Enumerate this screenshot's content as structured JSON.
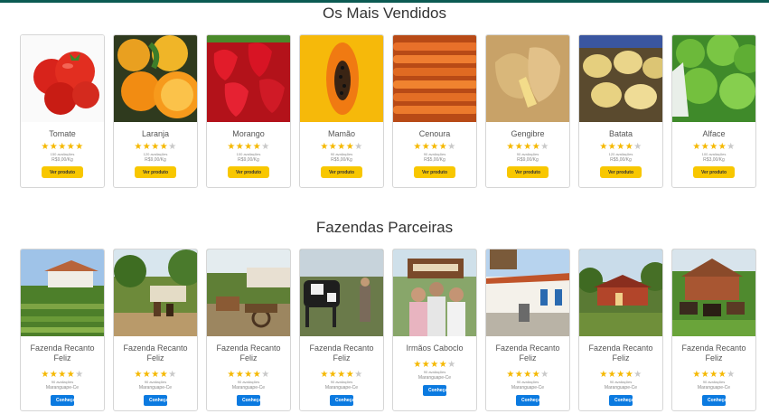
{
  "page": {
    "top_title": "Os Mais Vendidos",
    "farms_title": "Fazendas Parceiras"
  },
  "products": [
    {
      "name": "Tomate",
      "stars": 5,
      "reviews": "150 avaliações",
      "price": "R$9,00/Kg",
      "button": "Ver produto",
      "image": "tomato"
    },
    {
      "name": "Laranja",
      "stars": 4,
      "reviews": "120 avaliações",
      "price": "R$9,00/Kg",
      "button": "Ver produto",
      "image": "orange"
    },
    {
      "name": "Morango",
      "stars": 4,
      "reviews": "100 avaliações",
      "price": "R$9,00/Kg",
      "button": "Ver produto",
      "image": "strawberry"
    },
    {
      "name": "Mamão",
      "stars": 4,
      "reviews": "90 avaliações",
      "price": "R$5,00/Kg",
      "button": "Ver produto",
      "image": "papaya"
    },
    {
      "name": "Cenoura",
      "stars": 4,
      "reviews": "90 avaliações",
      "price": "R$5,00/Kg",
      "button": "Ver produto",
      "image": "carrot"
    },
    {
      "name": "Gengibre",
      "stars": 4,
      "reviews": "90 avaliações",
      "price": "R$9,00/Kg",
      "button": "Ver produto",
      "image": "ginger"
    },
    {
      "name": "Batata",
      "stars": 4,
      "reviews": "120 avaliações",
      "price": "R$5,00/Kg",
      "button": "Ver produto",
      "image": "potato"
    },
    {
      "name": "Alface",
      "stars": 4,
      "reviews": "100 avaliações",
      "price": "R$3,00/Kg",
      "button": "Ver produto",
      "image": "lettuce"
    }
  ],
  "farms": [
    {
      "name": "Fazenda Recanto Feliz",
      "stars": 4,
      "reviews": "90 avaliações",
      "location": "Maranguape-Ce",
      "button": "Conheça",
      "image": "farm-garden"
    },
    {
      "name": "Fazenda Recanto Feliz",
      "stars": 4,
      "reviews": "90 avaliações",
      "location": "Maranguape-Ce",
      "button": "Conheça",
      "image": "farm-horses"
    },
    {
      "name": "Fazenda Recanto Feliz",
      "stars": 4,
      "reviews": "90 avaliações",
      "location": "Maranguape-Ce",
      "button": "Conheça",
      "image": "farm-cart"
    },
    {
      "name": "Fazenda Recanto Feliz",
      "stars": 4,
      "reviews": "90 avaliações",
      "location": "Maranguape-Ce",
      "button": "Conheça",
      "image": "farm-cows"
    },
    {
      "name": "Irmãos Caboclo",
      "stars": 4,
      "reviews": "90 avaliações",
      "location": "Maranguape-Ce",
      "button": "Conheça",
      "image": "farm-people"
    },
    {
      "name": "Fazenda Recanto Feliz",
      "stars": 4,
      "reviews": "90 avaliações",
      "location": "Maranguape-Ce",
      "button": "Conheça",
      "image": "farm-house"
    },
    {
      "name": "Fazenda Recanto Feliz",
      "stars": 4,
      "reviews": "90 avaliações",
      "location": "Maranguape-Ce",
      "button": "Conheça",
      "image": "farm-red-house"
    },
    {
      "name": "Fazenda Recanto Feliz",
      "stars": 4,
      "reviews": "90 avaliações",
      "location": "Maranguape-Ce",
      "button": "Conheça",
      "image": "farm-goats"
    }
  ],
  "colors": {
    "topbar": "#0c5b53",
    "star_on": "#f5b800",
    "star_off": "#c9c9c9",
    "button_yellow": "#f8c700",
    "button_blue": "#0b7ae0"
  }
}
